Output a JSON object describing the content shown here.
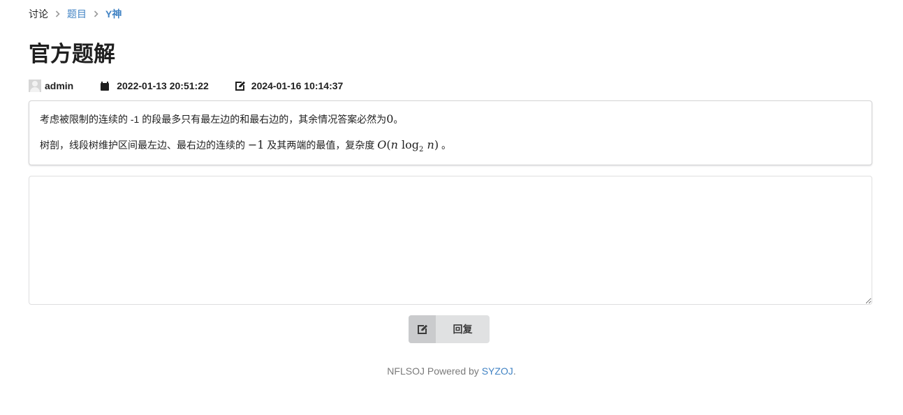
{
  "breadcrumb": {
    "items": [
      {
        "label": "讨论"
      },
      {
        "label": "题目"
      },
      {
        "label": "Y神"
      }
    ],
    "divider_icon": "chevron-right-icon"
  },
  "article": {
    "title": "官方题解",
    "author": "admin",
    "created": "2022-01-13 20:51:22",
    "edited": "2024-01-16 10:14:37",
    "icons": {
      "created": "calendar-icon",
      "edited": "edit-icon"
    },
    "content": {
      "line1_text": "考虑被限制的连续的 -1 的段最多只有最左边的和最右边的，其余情况答案必然为",
      "line1_math": "0",
      "line1_end": "。",
      "line2_text": "树剖，线段树维护区间最左边、最右边的连续的 ",
      "line2_math1": "−1",
      "line2_mid": " 及其两端的最值，复杂度 ",
      "line2_math2_O": "O",
      "line2_math2_n1": "n",
      "line2_math2_log": "log",
      "line2_math2_sub": "2",
      "line2_math2_n2": "n",
      "line2_end": " 。"
    }
  },
  "reply": {
    "textarea_value": "",
    "button_label": "回复",
    "button_icon": "edit-icon"
  },
  "footer": {
    "prefix": "NFLSOJ Powered by ",
    "link": "SYZOJ",
    "suffix": "."
  },
  "colors": {
    "link": "#4183c4",
    "button_bg": "#e0e1e2",
    "button_icon_bg": "#cacbcd",
    "border": "#d4d4d5"
  }
}
